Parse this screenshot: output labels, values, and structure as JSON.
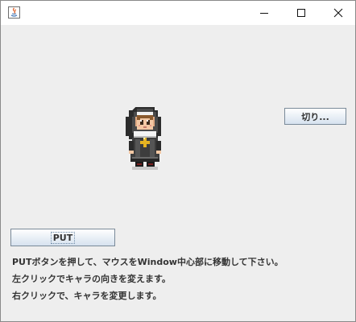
{
  "window": {
    "title": "",
    "controls": {
      "minimize": "minimize-icon",
      "maximize": "maximize-icon",
      "close": "close-icon"
    }
  },
  "main": {
    "cut_button_label": "切り...",
    "put_button_label": "PUT",
    "instructions": [
      "PUTボタンを押して、マウスをWindow中心部に移動して下さい。",
      "左クリックでキャラの向きを変えます。",
      "右クリックで、キャラを変更します。"
    ]
  },
  "colors": {
    "background": "#eeeeee",
    "titlebar": "#ffffff",
    "text": "#333333"
  }
}
